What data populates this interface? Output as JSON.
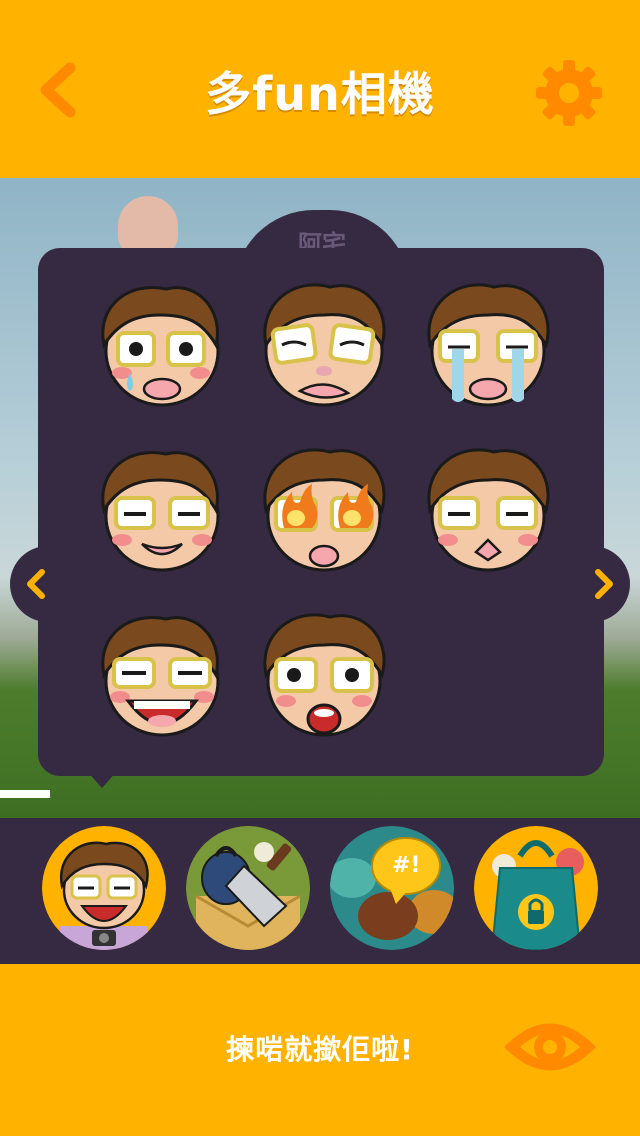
{
  "header": {
    "title": "多fun相機",
    "back_icon": "chevron-left-icon",
    "settings_icon": "gear-icon",
    "accent_color": "#ffb300",
    "icon_color": "#ff8a00"
  },
  "sticker_panel": {
    "tab_label": "阿宅",
    "panel_color": "#362942",
    "prev_icon": "chevron-left-icon",
    "next_icon": "chevron-right-icon",
    "stickers": [
      {
        "name": "nervous-sweat"
      },
      {
        "name": "sad-sneer"
      },
      {
        "name": "crying-tears"
      },
      {
        "name": "smug-smile"
      },
      {
        "name": "fiery-eyes"
      },
      {
        "name": "pouty-squint"
      },
      {
        "name": "laughing"
      },
      {
        "name": "shocked"
      }
    ]
  },
  "categories": [
    {
      "name": "otaku-face",
      "selected": true
    },
    {
      "name": "bag-and-cleaver"
    },
    {
      "name": "speech-bubbles"
    },
    {
      "name": "locked-shopping-bag",
      "locked": true
    }
  ],
  "footer": {
    "text": "揀啱就撳佢啦!",
    "eye_icon": "eye-icon"
  }
}
